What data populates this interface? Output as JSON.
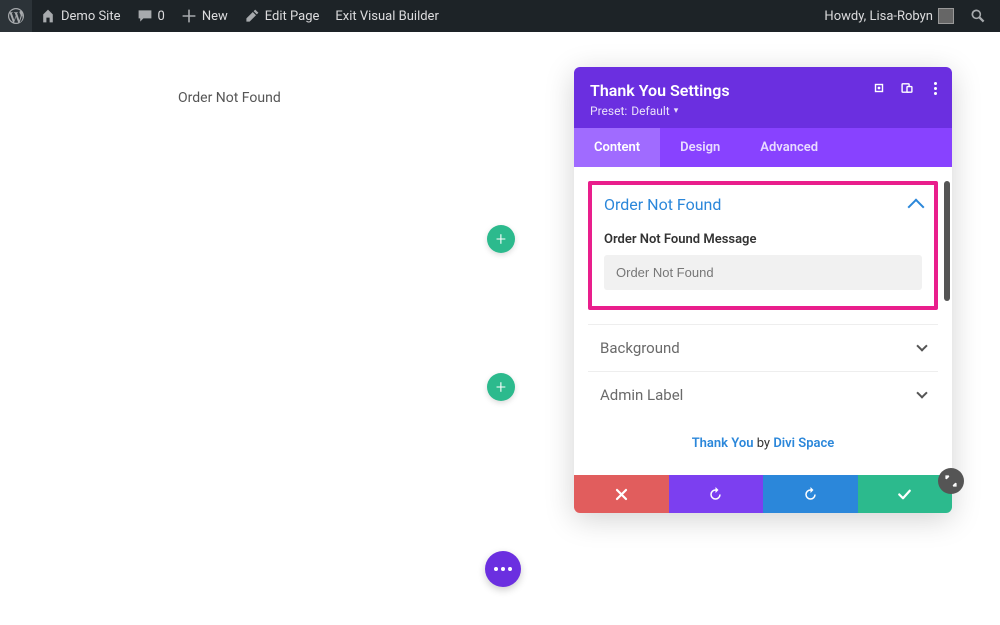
{
  "adminbar": {
    "site_name": "Demo Site",
    "comments": "0",
    "new": "New",
    "edit_page": "Edit Page",
    "exit_vb": "Exit Visual Builder",
    "howdy": "Howdy, Lisa-Robyn"
  },
  "canvas": {
    "text": "Order Not Found"
  },
  "panel": {
    "title": "Thank You Settings",
    "preset_prefix": "Preset:",
    "preset_value": "Default",
    "tabs": {
      "content": "Content",
      "design": "Design",
      "advanced": "Advanced"
    },
    "sections": {
      "order_not_found": {
        "title": "Order Not Found",
        "field_label": "Order Not Found Message",
        "input_value": "Order Not Found"
      },
      "background": "Background",
      "admin_label": "Admin Label"
    },
    "credit": {
      "product": "Thank You",
      "by": "by",
      "author": "Divi Space"
    }
  }
}
